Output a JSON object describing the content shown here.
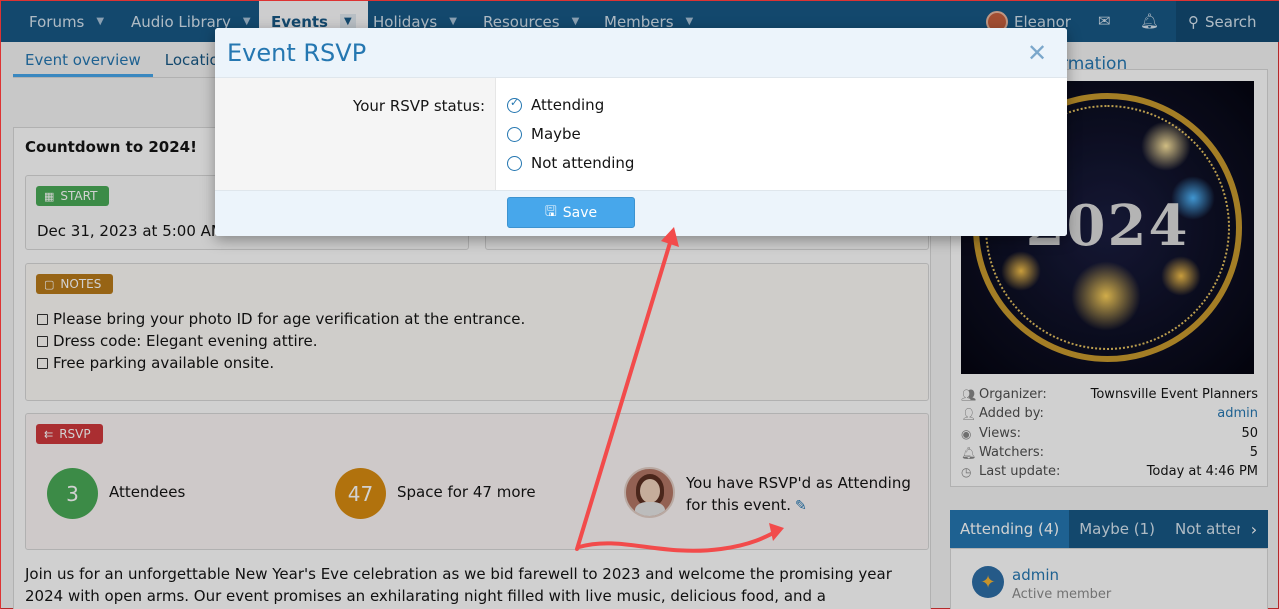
{
  "nav": {
    "items": [
      "Forums",
      "Audio Library",
      "Events",
      "Holidays",
      "Resources",
      "Members"
    ],
    "user": "Eleanor",
    "search": "Search"
  },
  "tabs": [
    "Event overview",
    "Location"
  ],
  "main": {
    "title": "Countdown to 2024!",
    "start_badge": "START",
    "start_value": "Dec 31, 2023 at 5:00 AM",
    "notes_badge": "NOTES",
    "notes": [
      "Please bring your photo ID for age verification at the entrance.",
      "Dress code: Elegant evening attire.",
      "Free parking available onsite."
    ],
    "rsvp_badge": "RSVP",
    "attendees_count": "3",
    "attendees_label": "Attendees",
    "space_count": "47",
    "space_label": "Space for 47 more",
    "rsvp_message_1": "You have RSVP'd as Attending",
    "rsvp_message_2": "for this event.",
    "description": "Join us for an unforgettable New Year's Eve celebration as we bid farewell to 2023 and welcome the promising year 2024 with open arms. Our event promises an exhilarating night filled with live music, delicious food, and a breathtaking fireworks display."
  },
  "sidebar": {
    "title": "rmation",
    "poster_text": "2024",
    "info": [
      {
        "label": "Organizer:",
        "value": "Townsville Event Planners"
      },
      {
        "label": "Added by:",
        "value": "admin"
      },
      {
        "label": "Views:",
        "value": "50"
      },
      {
        "label": "Watchers:",
        "value": "5"
      },
      {
        "label": "Last update:",
        "value": "Today at 4:46 PM"
      }
    ],
    "attendance_tabs": [
      "Attending (4)",
      "Maybe (1)",
      "Not attend"
    ],
    "member_name": "admin",
    "member_role": "Active member"
  },
  "modal": {
    "title": "Event RSVP",
    "close": "✕",
    "label": "Your RSVP status:",
    "options": [
      "Attending",
      "Maybe",
      "Not attending"
    ],
    "selected": "Attending",
    "save": "Save"
  },
  "colors": {
    "nav": "#185886",
    "accent": "#2577b1",
    "start_badge": "#4aaa57",
    "notes_badge": "#b97a1a",
    "rsvp_badge": "#d0393c",
    "attendees_circle": "#4aaa57",
    "space_circle": "#d88c11",
    "annotation_arrow": "#f24b4b"
  }
}
